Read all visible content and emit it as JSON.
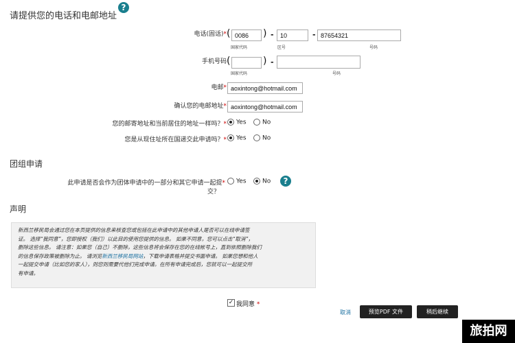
{
  "header": {
    "title": "请提供您的电话和电邮地址"
  },
  "phone": {
    "label": "电话(固话)",
    "country_code": "0086",
    "area_code": "10",
    "number": "87654321",
    "sub_country": "国家代码",
    "sub_area": "区号",
    "sub_number": "号码"
  },
  "mobile": {
    "label": "手机号码",
    "sub_country": "国家代码",
    "sub_number": "号码"
  },
  "email": {
    "label": "电邮",
    "value": "aoxintong@hotmail.com"
  },
  "confirm_email": {
    "label": "确认您的电邮地址",
    "value": "aoxintong@hotmail.com"
  },
  "q_same_address": {
    "label": "您的邮寄地址和当前居住的地址一样吗？",
    "yes": "Yes",
    "no": "No"
  },
  "q_residence": {
    "label": "您是从现住址所在国递交此申请吗？",
    "yes": "Yes",
    "no": "No"
  },
  "group": {
    "title": "团组申请",
    "question_line1": "此申请是否会作为团体申请中的一部分和其它申请一起提",
    "question_line2": "交？",
    "yes": "Yes",
    "no": "No"
  },
  "declaration": {
    "title": "声明",
    "lines": [
      "新西兰移民局会通过您在本页提供的信息来核查您或包括在此申请中的其他申请人是否可以在线申请签",
      "证。  选择“我同意”，您即授权（我们）以此目的使用您提供的信息。  如果不同意，您可以点击“取消”，",
      "删除这些信息。  请注意：如果您（自己）不删除，这些信息将会保存在您的在线帐号上，直到依照删除我们",
      "的信息保存政策被删除为止。  请浏览",
      "，下载申请表格并提交书面申请。 如果您想和他人",
      "一起提交申请（比如您的家人），则您则需要代他们完成申请。在所有申请完成后，您就可以一起提交所",
      "有申请。"
    ],
    "link_text": "新西兰移民局网站"
  },
  "agree": {
    "label": "我同意"
  },
  "actions": {
    "cancel": "取消",
    "preview_pdf": "预览PDF 文件",
    "save_continue": "稍后继续"
  },
  "corner_text": "旅拍网"
}
